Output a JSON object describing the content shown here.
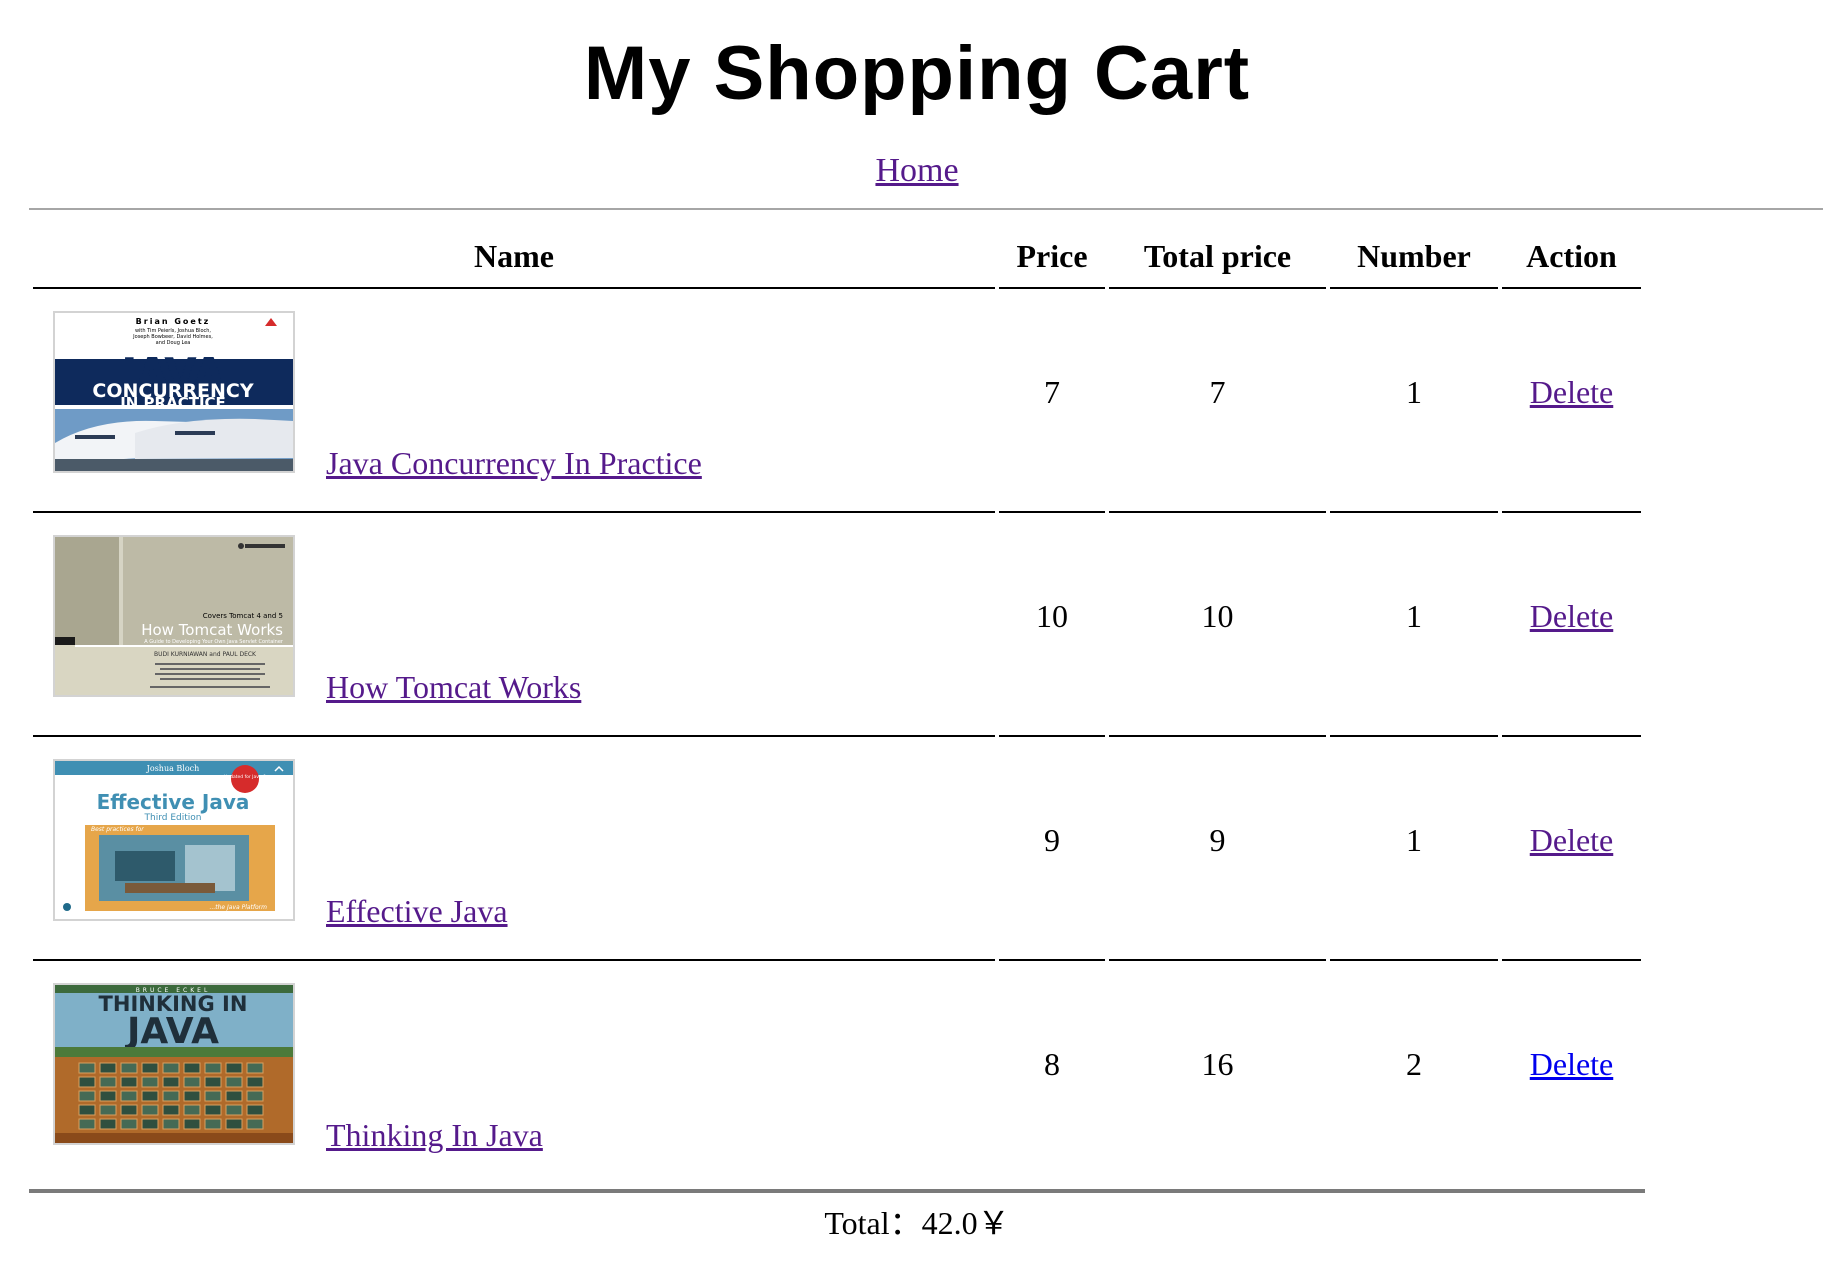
{
  "title": "My Shopping Cart",
  "nav": {
    "home": "Home"
  },
  "table": {
    "headers": {
      "name": "Name",
      "price": "Price",
      "total": "Total price",
      "number": "Number",
      "action": "Action"
    },
    "rows": [
      {
        "name": "Java Concurrency In Practice",
        "price": "7",
        "total": "7",
        "number": "1",
        "action": "Delete",
        "cover_icon": "java-concurrency-cover"
      },
      {
        "name": "How Tomcat Works",
        "price": "10",
        "total": "10",
        "number": "1",
        "action": "Delete",
        "cover_icon": "how-tomcat-works-cover"
      },
      {
        "name": "Effective Java",
        "price": "9",
        "total": "9",
        "number": "1",
        "action": "Delete",
        "cover_icon": "effective-java-cover"
      },
      {
        "name": "Thinking In Java",
        "price": "8",
        "total": "16",
        "number": "2",
        "action": "Delete",
        "cover_icon": "thinking-in-java-cover"
      }
    ]
  },
  "footer": {
    "total": "Total：42.0￥"
  },
  "covers": {
    "java_concurrency": {
      "author": "Brian Goetz",
      "coauthors_1": "with Tim Peierls, Joshua Bloch,",
      "coauthors_2": "Joseph Bowbeer, David Holmes,",
      "coauthors_3": "and Doug Lea",
      "title_big": "JAVA",
      "title_sub": "CONCURRENCY",
      "title_sub2": "IN PRACTICE"
    },
    "tomcat": {
      "covers": "Covers Tomcat 4 and 5",
      "title": "How Tomcat Works",
      "subtitle": "A Guide to Developing Your Own Java Servlet Container",
      "authors": "BUDI KURNIAWAN and PAUL DECK"
    },
    "effective_java": {
      "author": "Joshua Bloch",
      "badge": "Updated for Java 9",
      "title": "Effective Java",
      "edition": "Third Edition",
      "tagline": "Best practices for",
      "tagline_end": "...the Java Platform"
    },
    "thinking_java": {
      "author": "BRUCE ECKEL",
      "title_1": "THINKING IN",
      "title_2": "JAVA"
    }
  },
  "colors": {
    "visited_link": "#551a8b",
    "link": "#0000ee"
  }
}
